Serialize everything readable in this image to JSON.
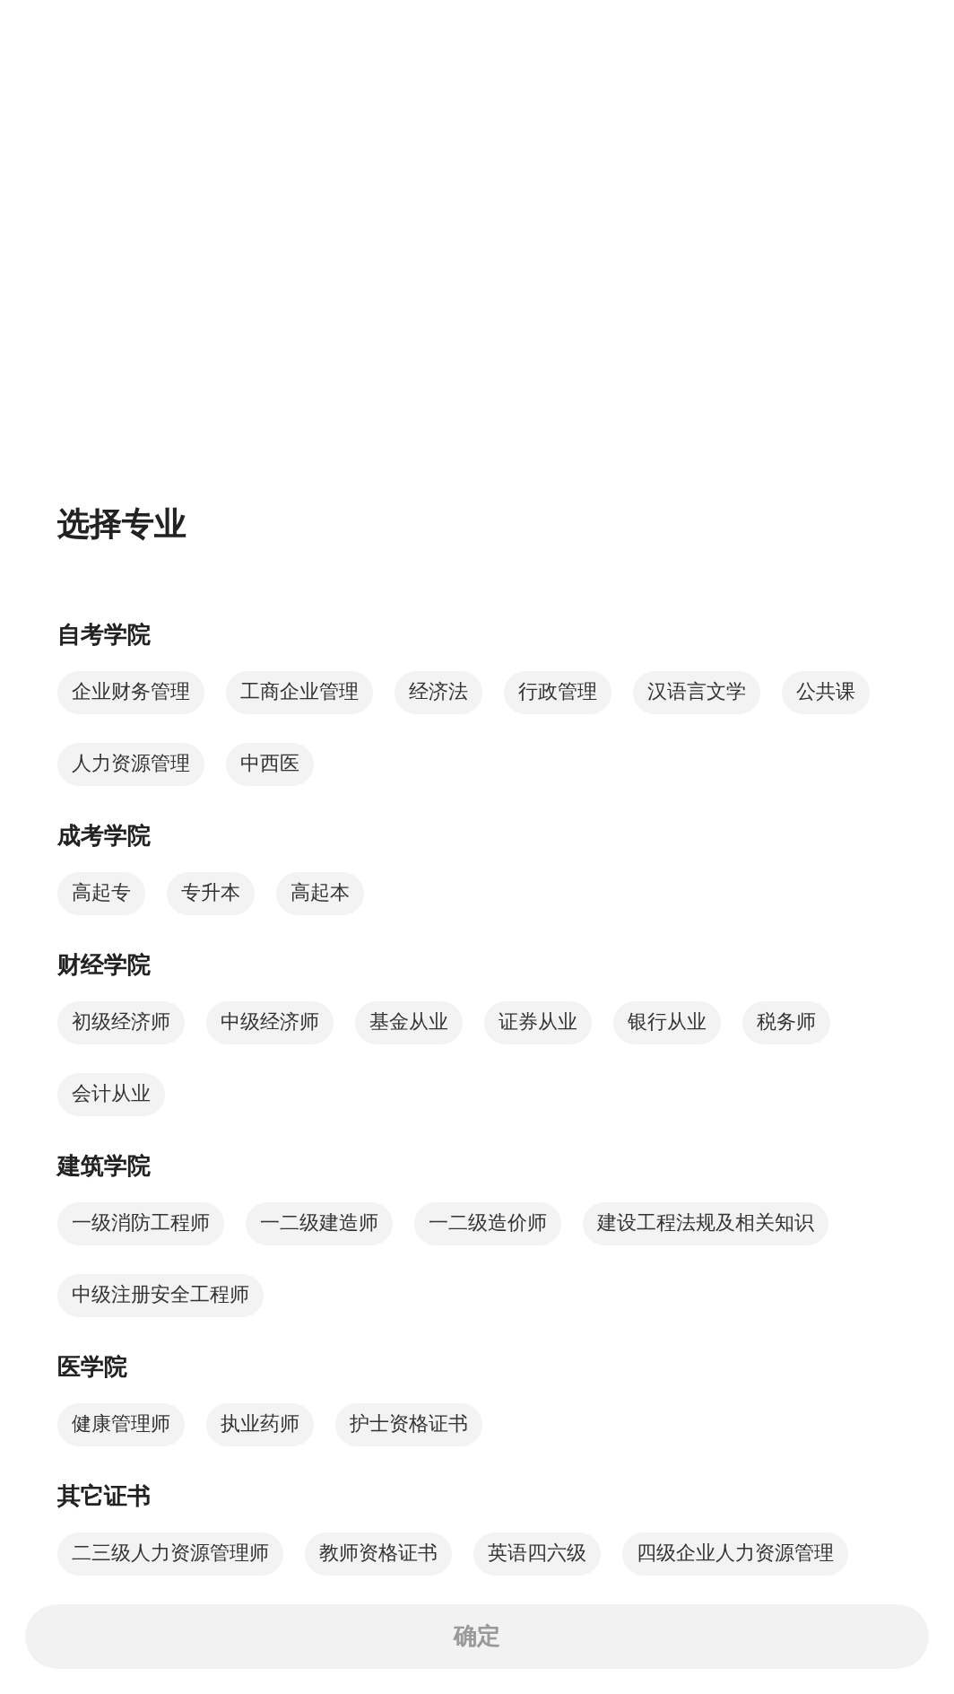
{
  "title": "选择专业",
  "sections": [
    {
      "heading": "自考学院",
      "options": [
        "企业财务管理",
        "工商企业管理",
        "经济法",
        "行政管理",
        "汉语言文学",
        "公共课",
        "人力资源管理",
        "中西医"
      ]
    },
    {
      "heading": "成考学院",
      "options": [
        "高起专",
        "专升本",
        "高起本"
      ]
    },
    {
      "heading": "财经学院",
      "options": [
        "初级经济师",
        "中级经济师",
        "基金从业",
        "证券从业",
        "银行从业",
        "税务师",
        "会计从业"
      ]
    },
    {
      "heading": "建筑学院",
      "options": [
        "一级消防工程师",
        "一二级建造师",
        "一二级造价师",
        "建设工程法规及相关知识",
        "中级注册安全工程师"
      ]
    },
    {
      "heading": "医学院",
      "options": [
        "健康管理师",
        "执业药师",
        "护士资格证书"
      ]
    },
    {
      "heading": "其它证书",
      "options": [
        "二三级人力资源管理师",
        "教师资格证书",
        "英语四六级",
        "四级企业人力资源管理"
      ]
    }
  ],
  "confirm_button": {
    "label": "确定",
    "disabled": true
  }
}
